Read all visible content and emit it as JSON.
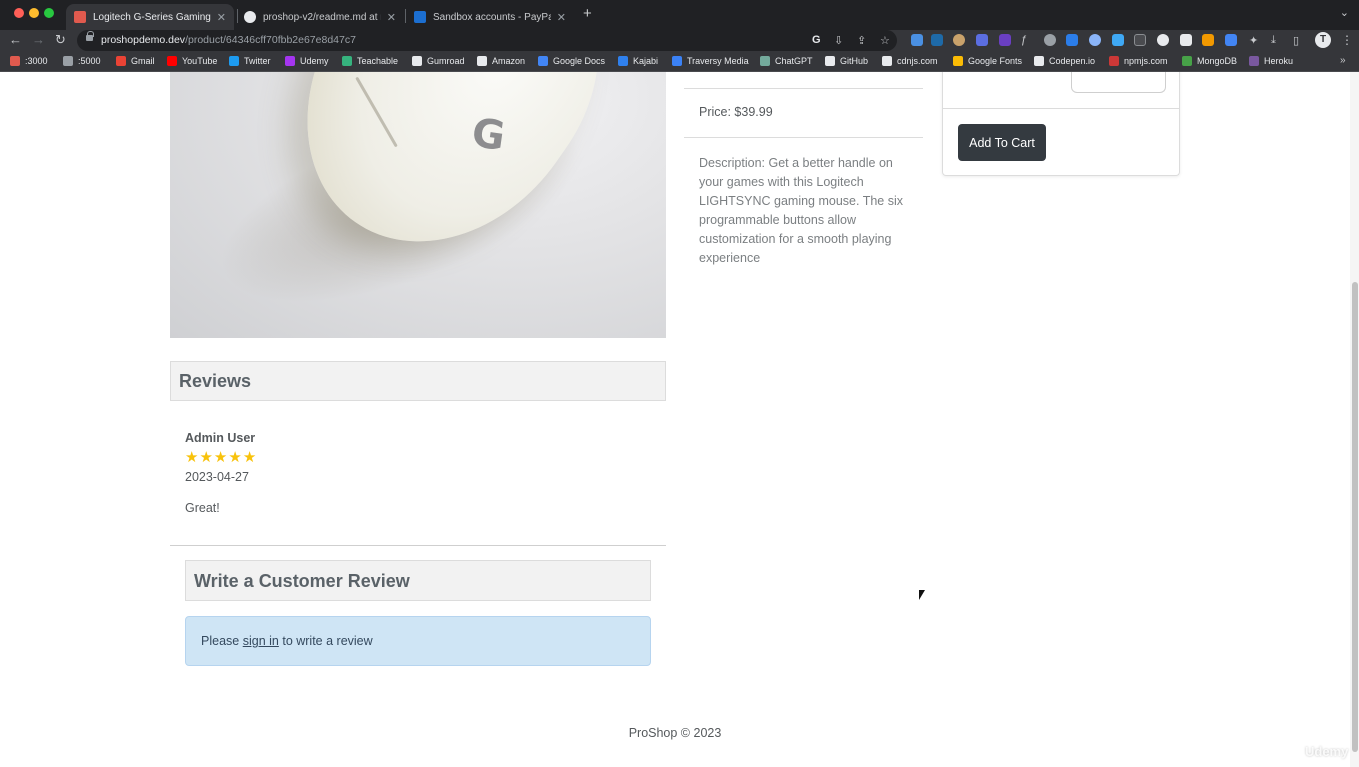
{
  "browser": {
    "tabs": [
      {
        "title": "Logitech G-Series Gaming Mo",
        "active": true,
        "favicon_color": "#e05a4e"
      },
      {
        "title": "proshop-v2/readme.md at mai",
        "active": false,
        "favicon_color": "#e8eaed"
      },
      {
        "title": "Sandbox accounts - PayPal De",
        "active": false,
        "favicon_color": "#1c6fd1"
      }
    ],
    "url_host": "proshopdemo.dev",
    "url_path": "/product/64346cff70fbb2e67e8d47c7",
    "profile_initial": "T",
    "bookmarks": [
      {
        "label": ":3000",
        "color": "#e05a4e"
      },
      {
        "label": ":5000",
        "color": "#9aa0a6"
      },
      {
        "label": "Gmail",
        "color": "#ea4335"
      },
      {
        "label": "YouTube",
        "color": "#ff0000"
      },
      {
        "label": "Twitter",
        "color": "#1d9bf0"
      },
      {
        "label": "Udemy",
        "color": "#a435f0"
      },
      {
        "label": "Teachable",
        "color": "#36b37e"
      },
      {
        "label": "Gumroad",
        "color": "#e8eaed"
      },
      {
        "label": "Amazon",
        "color": "#e8eaed"
      },
      {
        "label": "Google Docs",
        "color": "#4285f4"
      },
      {
        "label": "Kajabi",
        "color": "#2f80ed"
      },
      {
        "label": "Traversy Media",
        "color": "#3b82f6"
      },
      {
        "label": "ChatGPT",
        "color": "#74aa9c"
      },
      {
        "label": "GitHub",
        "color": "#e8eaed"
      },
      {
        "label": "cdnjs.com",
        "color": "#e8eaed"
      },
      {
        "label": "Google Fonts",
        "color": "#fbbc05"
      },
      {
        "label": "Codepen.io",
        "color": "#e8eaed"
      },
      {
        "label": "npmjs.com",
        "color": "#cb3837"
      },
      {
        "label": "MongoDB",
        "color": "#47a248"
      },
      {
        "label": "Heroku",
        "color": "#79589f"
      }
    ]
  },
  "product": {
    "logo_letter": "G",
    "price_line": "Price: $39.99",
    "description_line": "Description: Get a better handle on your games with this Logitech LIGHTSYNC gaming mouse. The six programmable buttons allow customization for a smooth playing experience",
    "add_to_cart_label": "Add To Cart"
  },
  "reviews": {
    "title": "Reviews",
    "items": [
      {
        "name": "Admin User",
        "rating": 5,
        "date": "2023-04-27",
        "comment": "Great!"
      }
    ],
    "write_title": "Write a Customer Review",
    "signin_prefix": "Please",
    "signin_link": "sign in",
    "signin_suffix": "to write a review"
  },
  "footer": {
    "text": "ProShop © 2023"
  },
  "watermark": "Udemy"
}
